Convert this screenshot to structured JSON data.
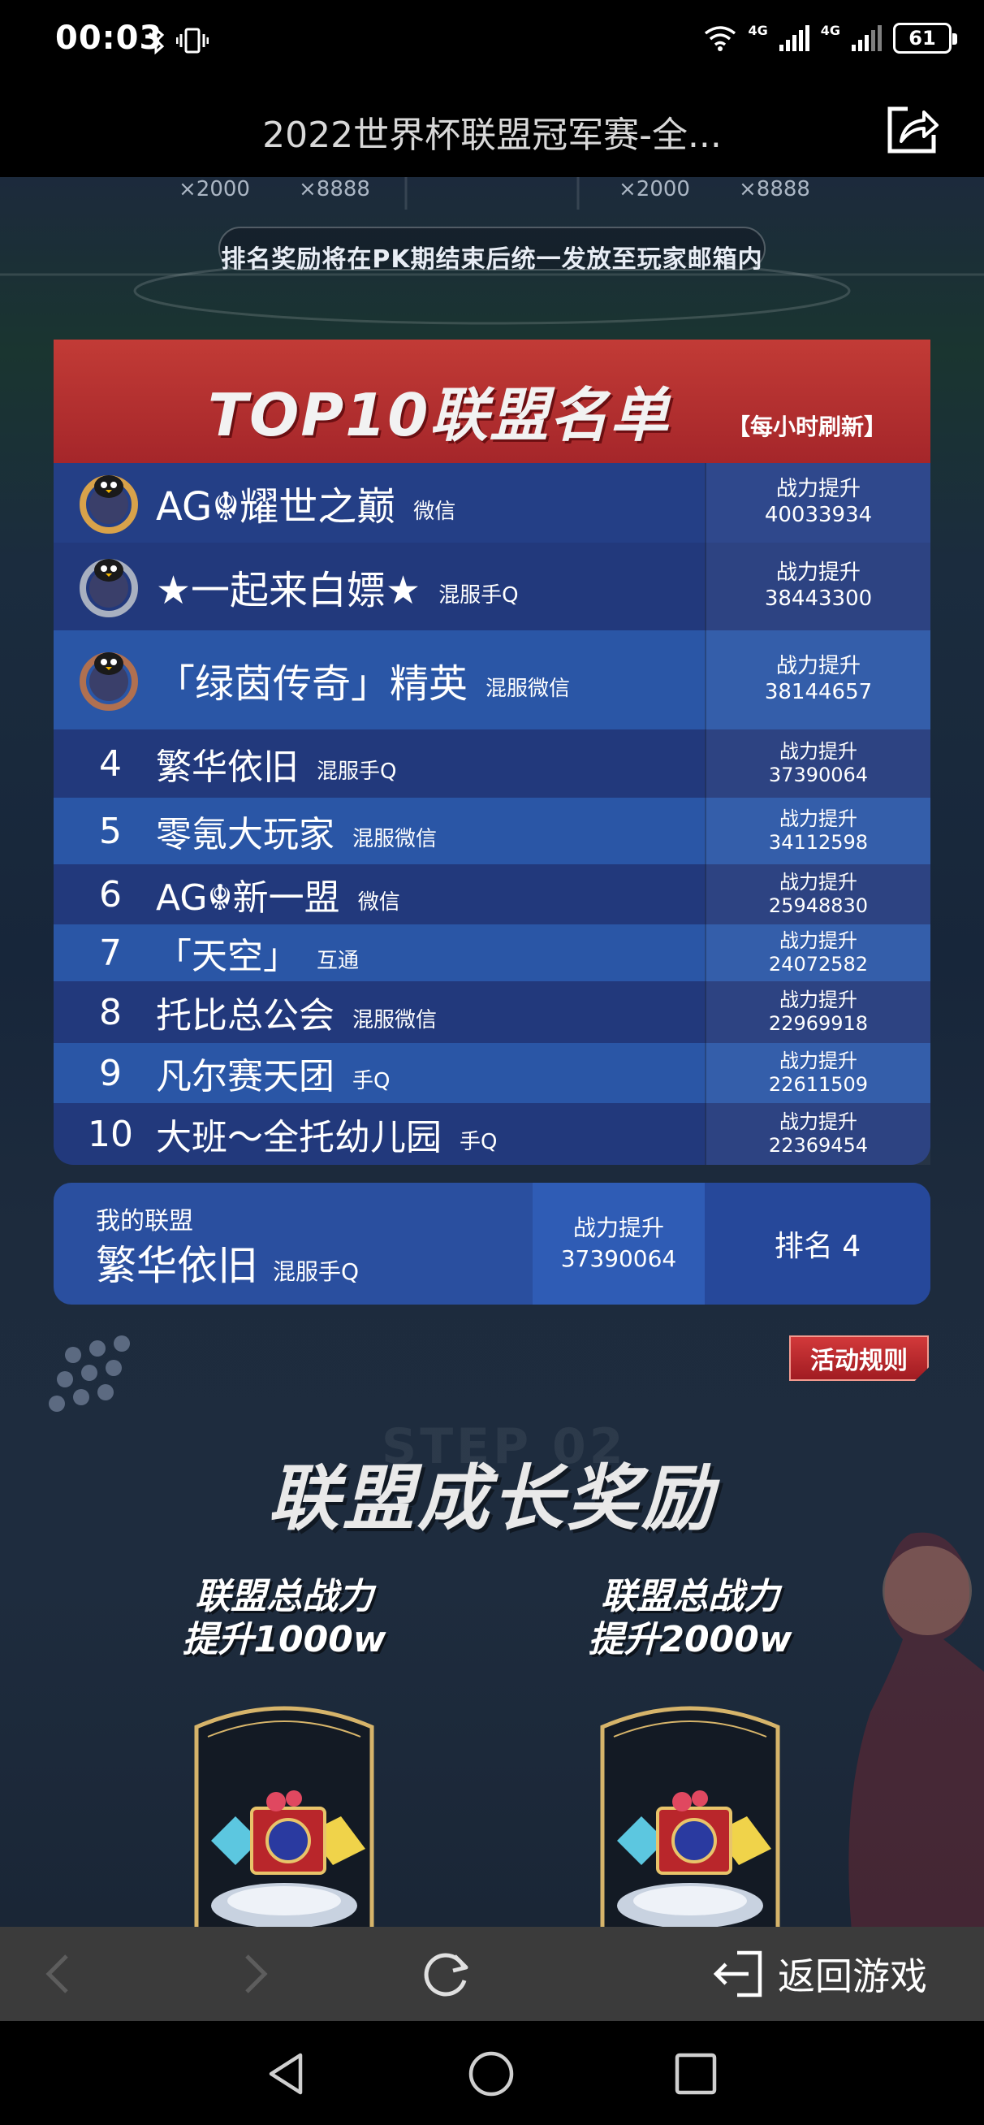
{
  "status_bar": {
    "time": "00:03",
    "left_icons": "✱ ▯",
    "net_1": "4G",
    "net_2": "4G",
    "battery": "61"
  },
  "title_bar": {
    "title": "2022世界杯联盟冠军赛-全..."
  },
  "content": {
    "top_cut_labels": [
      "×2000",
      "×8888",
      "×2000",
      "×8888"
    ],
    "notice": "排名奖励将在PK期结束后统一发放至玩家邮箱内",
    "ranking": {
      "title": "TOP10联盟名单",
      "subtitle": "【每小时刷新】",
      "rows": [
        {
          "rank": "1",
          "name": "AG☬耀世之巅",
          "server": "微信",
          "power_label": "战力提升",
          "power": "40033934"
        },
        {
          "rank": "2",
          "name": "★一起来白嫖★",
          "server": "混服手Q",
          "power_label": "战力提升",
          "power": "38443300"
        },
        {
          "rank": "3",
          "name": "「绿茵传奇」精英",
          "server": "混服微信",
          "power_label": "战力提升",
          "power": "38144657"
        },
        {
          "rank": "4",
          "name": "繁华依旧",
          "server": "混服手Q",
          "power_label": "战力提升",
          "power": "37390064"
        },
        {
          "rank": "5",
          "name": "零氪大玩家",
          "server": "混服微信",
          "power_label": "战力提升",
          "power": "34112598"
        },
        {
          "rank": "6",
          "name": "AG☬新一盟",
          "server": "微信",
          "power_label": "战力提升",
          "power": "25948830"
        },
        {
          "rank": "7",
          "name": "「天空」",
          "server": "互通",
          "power_label": "战力提升",
          "power": "24072582"
        },
        {
          "rank": "8",
          "name": "托比总公会",
          "server": "混服微信",
          "power_label": "战力提升",
          "power": "22969918"
        },
        {
          "rank": "9",
          "name": "凡尔赛天团",
          "server": "手Q",
          "power_label": "战力提升",
          "power": "22611509"
        },
        {
          "rank": "10",
          "name": "大班～全托幼儿园",
          "server": "手Q",
          "power_label": "战力提升",
          "power": "22369454"
        }
      ]
    },
    "my_alliance": {
      "label": "我的联盟",
      "name": "繁华依旧",
      "server": "混服手Q",
      "power_label": "战力提升",
      "power": "37390064",
      "rank_text": "排名 4"
    },
    "rules_button": "活动规则",
    "growth": {
      "watermark": "STEP 02",
      "title": "联盟成长奖励",
      "rewards": [
        {
          "line1": "联盟总战力",
          "line2": "提升1000w"
        },
        {
          "line1": "联盟总战力",
          "line2": "提升2000w"
        }
      ]
    }
  },
  "browser_bar": {
    "return_label": "返回游戏"
  },
  "colors": {
    "header_red": "#b22f2f",
    "row_dark": "#243f86",
    "row_light": "#2a56a6",
    "browser_bar": "#3b3b3b"
  }
}
